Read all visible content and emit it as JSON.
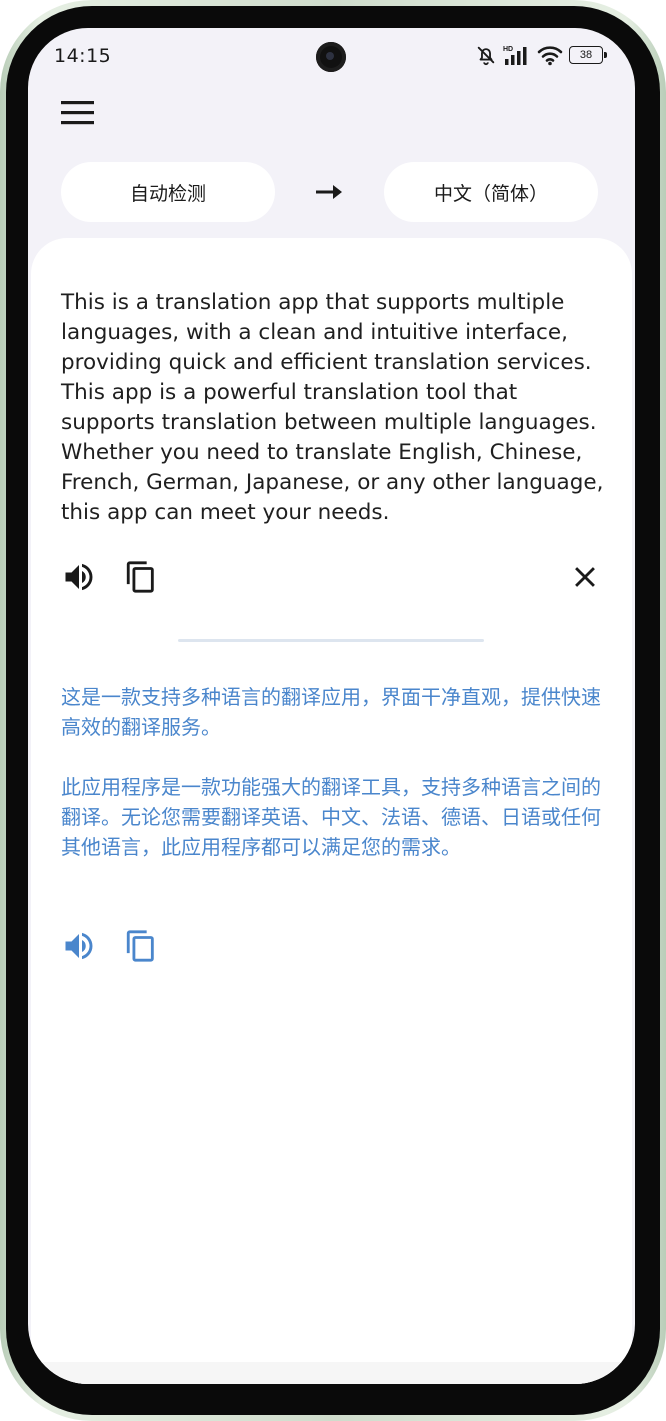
{
  "status_bar": {
    "time": "14:15",
    "battery": "38",
    "icons": [
      "bell-off-icon",
      "hd-signal-icon",
      "wifi-icon",
      "battery-icon"
    ]
  },
  "header": {
    "menu_icon": "hamburger-menu-icon",
    "source_language": "自动检测",
    "target_language": "中文（简体）",
    "swap_icon": "arrow-right-icon"
  },
  "source": {
    "text": "This is a translation app that supports multiple languages, with a clean and intuitive interface, providing quick and efficient translation services. This app is a powerful translation tool that supports translation between multiple languages. Whether you need to translate English, Chinese, French, German, Japanese, or any other language, this app can meet your needs.",
    "actions": [
      "speaker-icon",
      "copy-icon",
      "close-icon"
    ]
  },
  "translation": {
    "text": "这是一款支持多种语言的翻译应用，界面干净直观，提供快速高效的翻译服务。\n\n此应用程序是一款功能强大的翻译工具，支持多种语言之间的翻译。无论您需要翻译英语、中文、法语、德语、日语或任何其他语言，此应用程序都可以满足您的需求。",
    "actions": [
      "speaker-icon",
      "copy-icon"
    ]
  },
  "colors": {
    "background": "#f3f2f8",
    "card": "#ffffff",
    "source_text": "#1f1f1f",
    "translation_accent": "#4a86cc",
    "icon_dark": "#1a1a1a"
  }
}
